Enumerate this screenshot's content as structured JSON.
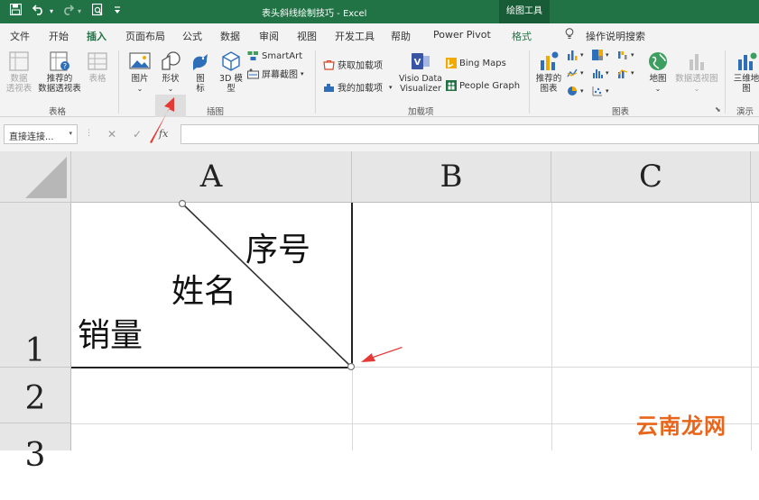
{
  "title_bar": {
    "title": "表头斜线绘制技巧 - Excel",
    "context_tab": "绘图工具"
  },
  "quick_access": {
    "save_icon": "save-icon",
    "undo_icon": "undo-icon",
    "redo_icon": "redo-icon",
    "preview_icon": "print-preview-icon",
    "customize_icon": "customize-icon"
  },
  "tabs": [
    "文件",
    "开始",
    "插入",
    "页面布局",
    "公式",
    "数据",
    "审阅",
    "视图",
    "开发工具",
    "帮助",
    "Power Pivot",
    "格式"
  ],
  "active_tab": "插入",
  "tell_me": "操作说明搜索",
  "ribbon": {
    "tables": {
      "group": "表格",
      "pivot_line1": "数据",
      "pivot_line2": "透视表",
      "rec_pivot_line1": "推荐的",
      "rec_pivot_line2": "数据透视表",
      "table": "表格"
    },
    "illustrations": {
      "group": "插图",
      "pictures": "图片",
      "shapes": "形状",
      "icons_line1": "图",
      "icons_line2": "标",
      "model3d_line1": "3D 模",
      "model3d_line2": "型",
      "smartart": "SmartArt",
      "screenshot": "屏幕截图"
    },
    "addins": {
      "group": "加载项",
      "get": "获取加载项",
      "my": "我的加载项",
      "visio_line1": "Visio Data",
      "visio_line2": "Visualizer",
      "bing": "Bing Maps",
      "people": "People Graph"
    },
    "charts": {
      "group": "图表",
      "recommended_line1": "推荐的",
      "recommended_line2": "图表",
      "maps": "地图",
      "pivot_chart": "数据透视图"
    },
    "tours": {
      "group": "演示",
      "map3d_line1": "三维地",
      "map3d_line2": "图"
    }
  },
  "formula_bar": {
    "name_box": "直接连接...",
    "cancel": "✕",
    "enter": "✓",
    "fx": "fx",
    "value": ""
  },
  "sheet": {
    "columns": [
      "A",
      "B",
      "C"
    ],
    "rows": [
      "1",
      "2",
      "3"
    ],
    "cell_a1_texts": {
      "top": "序号",
      "middle": "姓名",
      "bottom": "销量"
    }
  },
  "watermark": "云南龙网",
  "colors": {
    "excel_green": "#217346",
    "annotation_red": "#e53935"
  }
}
